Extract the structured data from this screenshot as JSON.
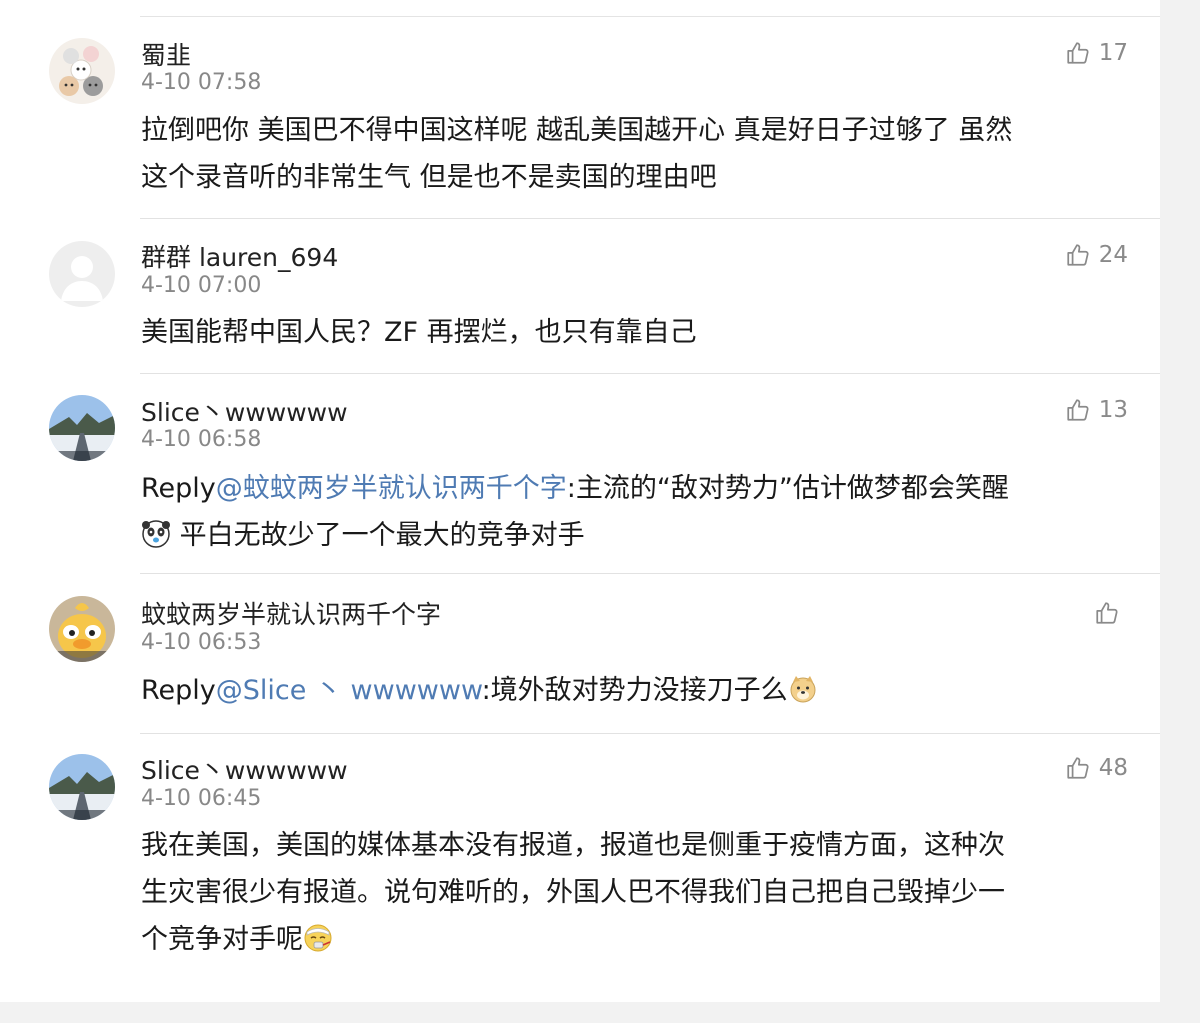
{
  "comments": [
    {
      "username": "蜀韭",
      "time": "4-10 07:58",
      "likes": "17",
      "lines": [
        "拉倒吧你 美国巴不得中国这样呢 越乱美国越开心 真是好日子过够了 虽然",
        "这个录音听的非常生气 但是也不是卖国的理由吧"
      ],
      "avatar": "cat-pile-avatar"
    },
    {
      "username": "群群 lauren_694",
      "time": "4-10 07:00",
      "likes": "24",
      "lines": [
        "美国能帮中国人民？ZF 再摆烂，也只有靠自己"
      ],
      "avatar": "default-person-avatar"
    },
    {
      "username": "Slice丶wwwwww",
      "time": "4-10 06:58",
      "likes": "13",
      "reply_prefix": "Reply",
      "reply_target": "@蚊蚊两岁半就认识两千个字",
      "line1_rest": ":主流的“敌对势力”估计做梦都会笑醒",
      "line2_emoji": "panda-face-emoji",
      "line2_text": " 平白无故少了一个最大的竞争对手",
      "avatar": "winter-road-avatar"
    },
    {
      "username": "蚊蚊两岁半就认识两千个字",
      "time": "4-10 06:53",
      "likes": "",
      "reply_prefix": "Reply",
      "reply_target": "@Slice 丶 wwwwww",
      "line1_rest": ":境外敌对势力没接刀子么",
      "line1_emoji": "doge-emoji",
      "avatar": "yellow-duck-avatar"
    },
    {
      "username": "Slice丶wwwwww",
      "time": "4-10 06:45",
      "likes": "48",
      "lines": [
        "我在美国，美国的媒体基本没有报道，报道也是侧重于疫情方面，这种次",
        "生灾害很少有报道。说句难听的，外国人巴不得我们自己把自己毁掉少一"
      ],
      "line3_text": "个竞争对手呢",
      "line3_emoji": "sick-face-emoji",
      "avatar": "winter-road-avatar"
    }
  ],
  "colors": {
    "reply_link": "#4f7bb3",
    "meta_gray": "#888888",
    "divider": "#e2e2e2"
  },
  "icons": {
    "like": "thumbs-up-icon"
  }
}
